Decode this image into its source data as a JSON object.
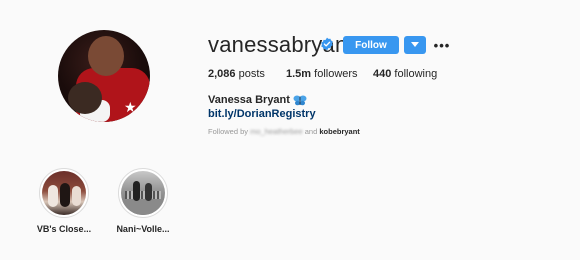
{
  "profile": {
    "username": "vanessabryant",
    "verified": true,
    "follow_label": "Follow",
    "stats": {
      "posts_count": "2,086",
      "posts_label": "posts",
      "followers_count": "1.5m",
      "followers_label": "followers",
      "following_count": "440",
      "following_label": "following"
    },
    "full_name": "Vanessa Bryant",
    "bio_link": "bit.ly/DorianRegistry",
    "followed_by": {
      "prefix": "Followed by",
      "blurred_name": "mo_heatherbee",
      "conjunction": "and",
      "name": "kobebryant"
    }
  },
  "highlights": [
    {
      "label": "VB's Close..."
    },
    {
      "label": "Nani~Volle..."
    }
  ],
  "colors": {
    "accent": "#3897f0",
    "link": "#003569",
    "background": "#fafafa"
  },
  "icons": {
    "verified": "verified-badge-icon",
    "dropdown": "chevron-down-icon",
    "more": "more-options-icon",
    "butterfly": "butterfly-emoji-icon"
  }
}
